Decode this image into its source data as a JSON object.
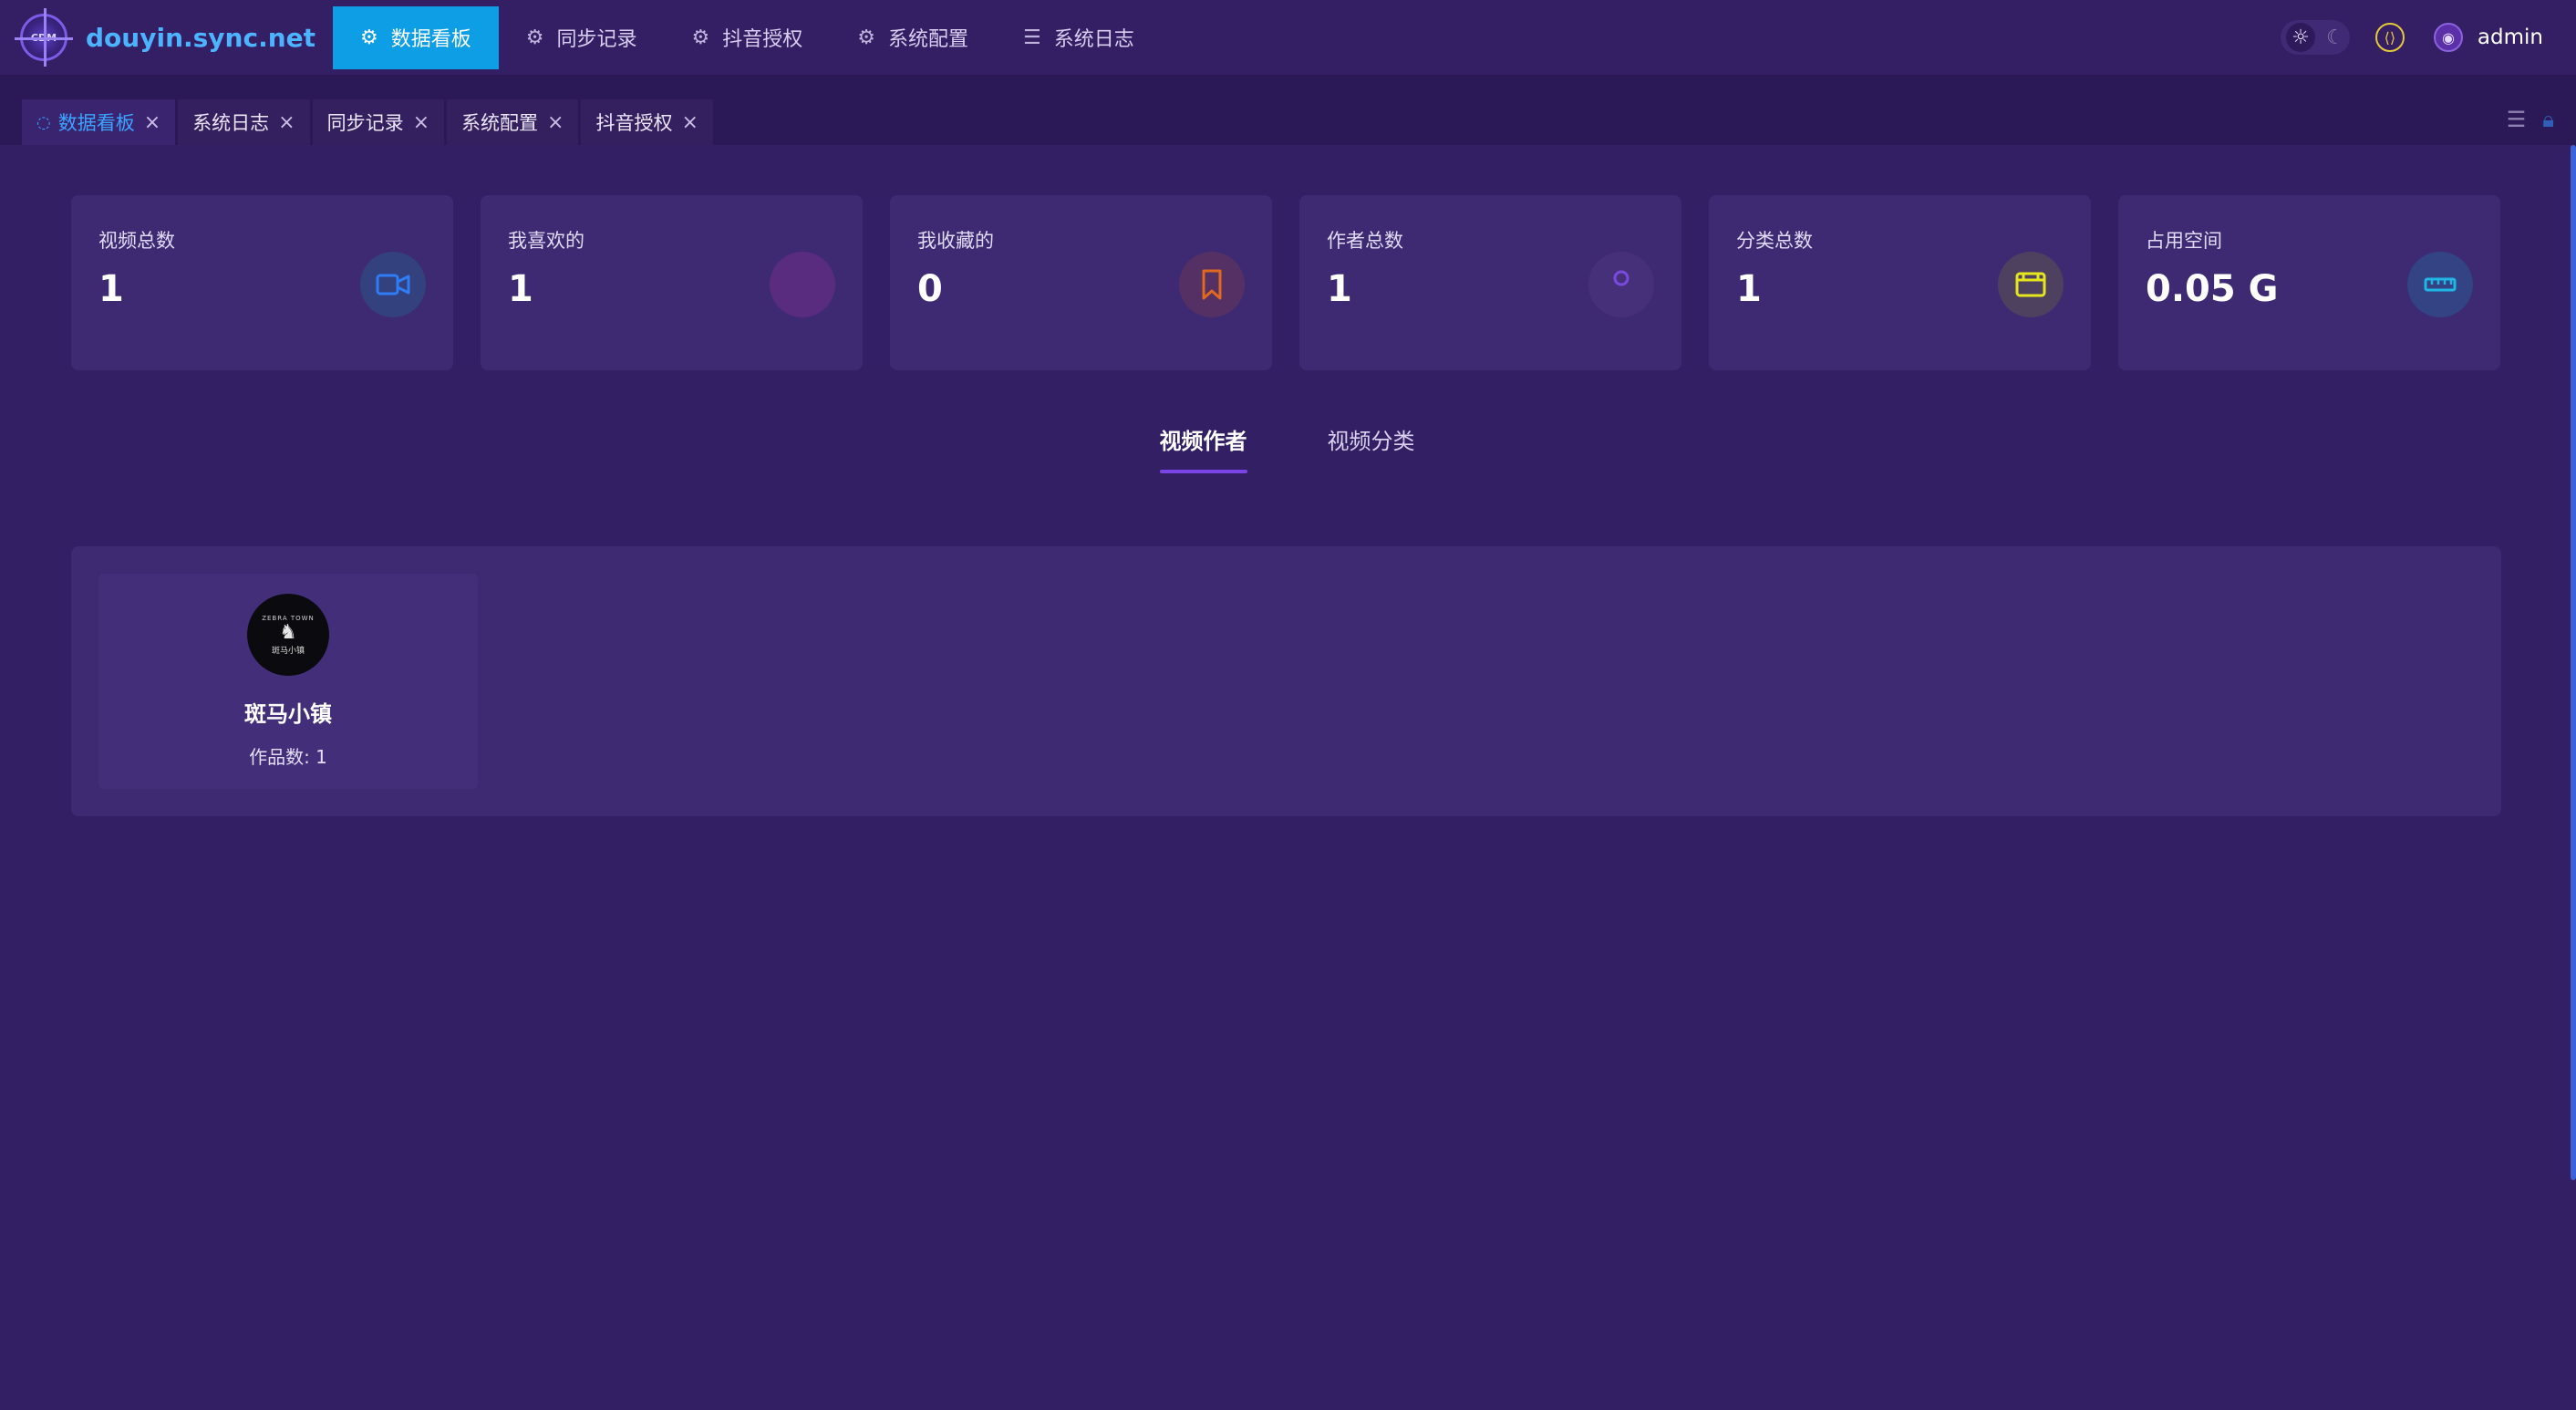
{
  "app": {
    "title": "douyin.sync.net",
    "logo_text": "CDM"
  },
  "nav": [
    {
      "label": "数据看板",
      "icon": "gear-icon",
      "glyph": "⚙",
      "active": true
    },
    {
      "label": "同步记录",
      "icon": "gear-icon",
      "glyph": "⚙",
      "active": false
    },
    {
      "label": "抖音授权",
      "icon": "gear-icon",
      "glyph": "⚙",
      "active": false
    },
    {
      "label": "系统配置",
      "icon": "gear-icon",
      "glyph": "⚙",
      "active": false
    },
    {
      "label": "系统日志",
      "icon": "list-icon",
      "glyph": "☰",
      "active": false
    }
  ],
  "header": {
    "user": "admin"
  },
  "tabs": [
    {
      "label": "数据看板",
      "active": true
    },
    {
      "label": "系统日志",
      "active": false
    },
    {
      "label": "同步记录",
      "active": false
    },
    {
      "label": "系统配置",
      "active": false
    },
    {
      "label": "抖音授权",
      "active": false
    }
  ],
  "stats": [
    {
      "label": "视频总数",
      "value": "1",
      "icon": "video-camera-icon",
      "color": "#2f7cf6",
      "bg": "#33417e"
    },
    {
      "label": "我喜欢的",
      "value": "1",
      "icon": "heart-icon",
      "color": "#e23bd7",
      "bg": "#592c80"
    },
    {
      "label": "我收藏的",
      "value": "0",
      "icon": "bookmark-icon",
      "color": "#e0691d",
      "bg": "#543065"
    },
    {
      "label": "作者总数",
      "value": "1",
      "icon": "user-icon",
      "color": "#7a4ae0",
      "bg": "#463079"
    },
    {
      "label": "分类总数",
      "value": "1",
      "icon": "category-box-icon",
      "color": "#e6e61c",
      "bg": "#4e4160"
    },
    {
      "label": "占用空间",
      "value": "0.05 G",
      "icon": "ruler-icon",
      "color": "#1fb8e6",
      "bg": "#334384"
    }
  ],
  "subtabs": [
    {
      "label": "视频作者",
      "active": true
    },
    {
      "label": "视频分类",
      "active": false
    }
  ],
  "authors": [
    {
      "name": "斑马小镇",
      "works": "作品数: 1",
      "avatar_lines": [
        "ZEBRA TOWN",
        "斑马小镇"
      ]
    }
  ]
}
